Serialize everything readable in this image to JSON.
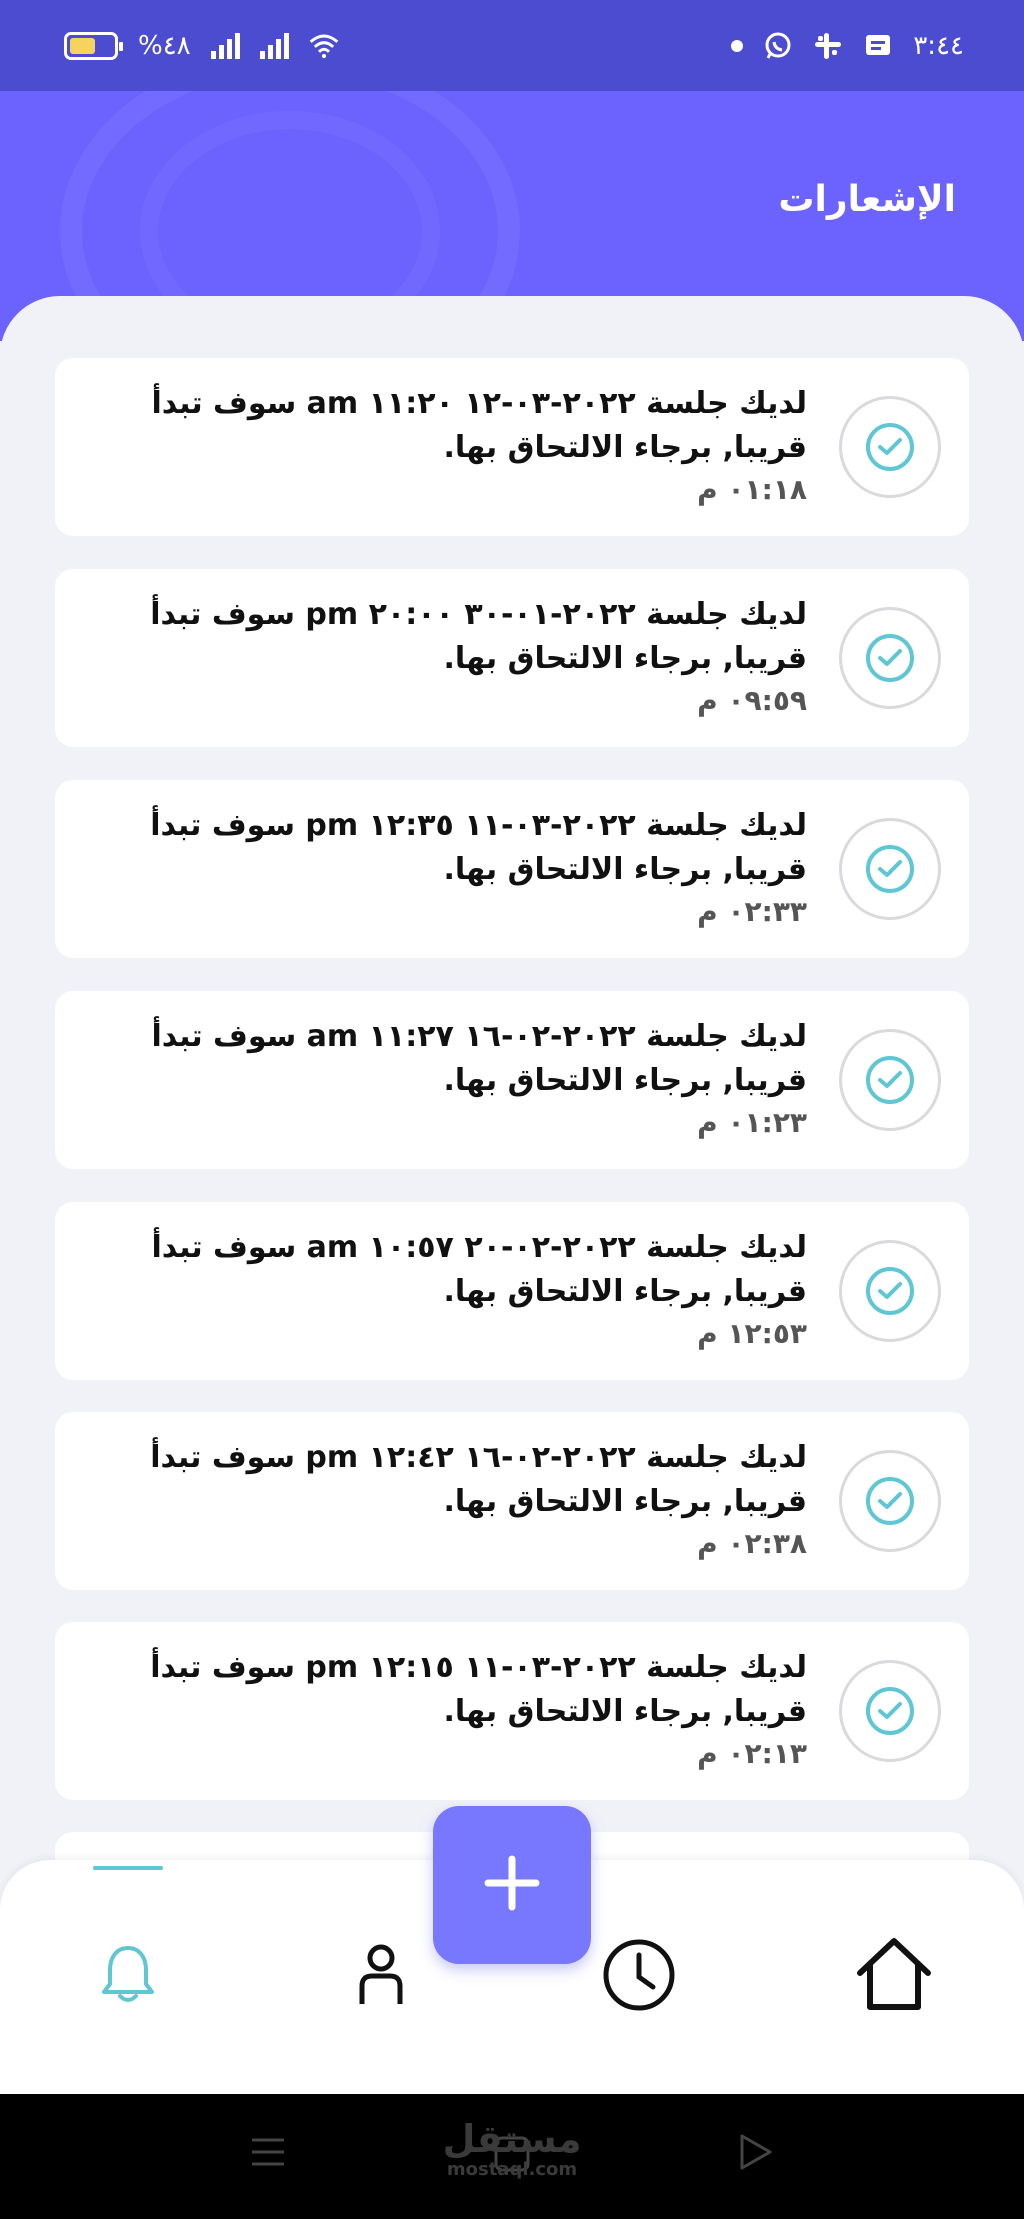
{
  "status_bar": {
    "time": "٣:٤٤",
    "battery_percent": "%٤٨",
    "battery_level": 0.48,
    "icons": [
      "dot-icon",
      "whatsapp-icon",
      "slack-icon",
      "message-icon",
      "wifi-icon",
      "signal-icon",
      "signal-icon",
      "battery-icon"
    ]
  },
  "header": {
    "title": "الإشعارات"
  },
  "notifications": [
    {
      "message": "لديك جلسة ٢٠٢٢-٠٣-١٢ ١١:٢٠ am سوف تبدأ قريبا, برجاء الالتحاق بها.",
      "time": "٠١:١٨ م"
    },
    {
      "message": "لديك جلسة ٢٠٢٢-٠١-٣٠ ٢٠:٠٠ pm سوف تبدأ قريبا, برجاء الالتحاق بها.",
      "time": "٠٩:٥٩ م"
    },
    {
      "message": "لديك جلسة ٢٠٢٢-٠٣-١١ ١٢:٣٥ pm سوف تبدأ قريبا, برجاء الالتحاق بها.",
      "time": "٠٢:٣٣ م"
    },
    {
      "message": "لديك جلسة ٢٠٢٢-٠٢-١٦ ١١:٢٧ am سوف تبدأ قريبا, برجاء الالتحاق بها.",
      "time": "٠١:٢٣ م"
    },
    {
      "message": "لديك جلسة ٢٠٢٢-٠٢-٢٠ ١٠:٥٧ am سوف تبدأ قريبا, برجاء الالتحاق بها.",
      "time": "١٢:٥٣ م"
    },
    {
      "message": "لديك جلسة ٢٠٢٢-٠٢-١٦ ١٢:٤٢ pm سوف تبدأ قريبا, برجاء الالتحاق بها.",
      "time": "٠٢:٣٨ م"
    },
    {
      "message": "لديك جلسة ٢٠٢٢-٠٣-١١ ١٢:١٥ pm سوف تبدأ قريبا, برجاء الالتحاق بها.",
      "time": "٠٢:١٣ م"
    }
  ],
  "bottom_nav": {
    "items": [
      {
        "icon": "bell-icon",
        "active": true
      },
      {
        "icon": "profile-icon",
        "active": false
      },
      {
        "icon": "clock-icon",
        "active": false
      },
      {
        "icon": "home-icon",
        "active": false
      }
    ],
    "fab_icon": "plus-icon"
  },
  "watermark": {
    "arabic": "مستقل",
    "latin": "mostaql.com"
  },
  "colors": {
    "status_bar": "#4c4cd0",
    "header": "#6c63ff",
    "accent": "#5fc6d4",
    "fab": "#7878ff",
    "background": "#f1f2f8"
  }
}
